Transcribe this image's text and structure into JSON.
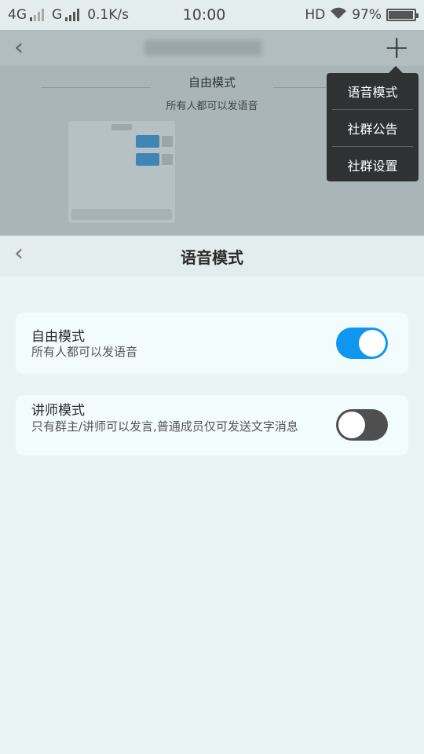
{
  "status_bar": {
    "network_1": "4G",
    "network_2": "G",
    "speed": "0.1K/s",
    "time": "10:00",
    "hd": "HD",
    "battery_percent": "97%",
    "battery_level": 0.97
  },
  "background_screen": {
    "mode_title": "自由模式",
    "mode_subtitle": "所有人都可以发语音"
  },
  "dropdown_menu": {
    "items": [
      "语音模式",
      "社群公告",
      "社群设置"
    ]
  },
  "header": {
    "title": "语音模式"
  },
  "modes": [
    {
      "title": "自由模式",
      "description": "所有人都可以发语音",
      "enabled": true
    },
    {
      "title": "讲师模式",
      "description": "只有群主/讲师可以发言,普通成员仅可发送文字消息",
      "enabled": false
    }
  ],
  "colors": {
    "accent": "#0f97f0",
    "toggle_off": "#4f4f4f",
    "menu_bg": "#2e3233"
  }
}
